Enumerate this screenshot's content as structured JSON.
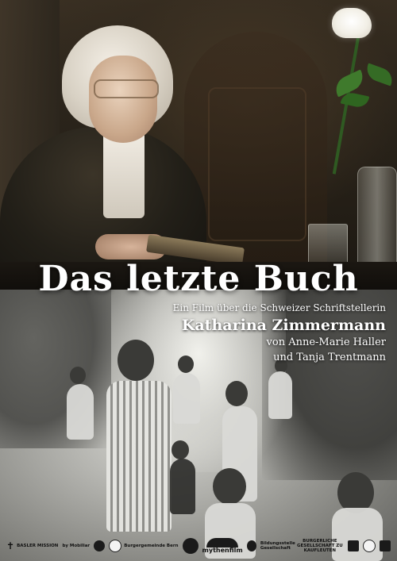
{
  "poster": {
    "title": "Das letzte Buch",
    "subtitle": "Ein Film über die Schweizer Schriftstellerin",
    "author": "Katharina Zimmermann",
    "director_line_1": "von Anne-Marie Haller",
    "director_line_2": "und Tanja Trentmann"
  },
  "logos": [
    {
      "text": "BASLER MISSION"
    },
    {
      "text": "by Mobiliar"
    },
    {
      "text": "Burgergemeinde Bern"
    },
    {
      "text": "BE migros"
    },
    {
      "text": "mythenfilm"
    },
    {
      "text": ""
    },
    {
      "text": "Bildungsstelle Gesellschaft"
    },
    {
      "text": "BURGERLICHE GESELLSCHAFT ZU KAUFLEUTEN"
    },
    {
      "text": ""
    },
    {
      "text": ""
    },
    {
      "text": ""
    }
  ]
}
